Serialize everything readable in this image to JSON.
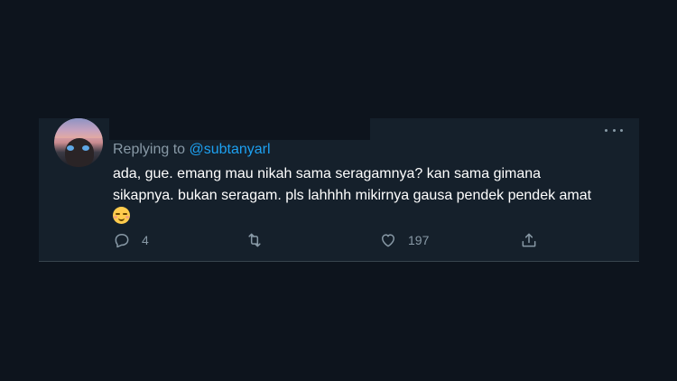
{
  "tweet": {
    "replying_prefix": "Replying to ",
    "replying_handle": "@subtanyarl",
    "text_line1": "ada, gue. emang mau nikah sama seragamnya? kan sama gimana",
    "text_line2": "sikapnya. bukan seragam. pls lahhhh mikirnya gausa pendek pendek amat",
    "emoji": "relieved-face"
  },
  "actions": {
    "reply_count": "4",
    "retweet_count": "",
    "like_count": "197"
  },
  "icons": {
    "more": "more-horizontal-icon",
    "reply": "reply-bubble-icon",
    "retweet": "retweet-icon",
    "like": "heart-icon",
    "share": "share-icon"
  },
  "colors": {
    "background": "#0d141d",
    "card": "#15202b",
    "muted_text": "#8899a6",
    "link": "#1da1f2",
    "text": "#ffffff"
  }
}
